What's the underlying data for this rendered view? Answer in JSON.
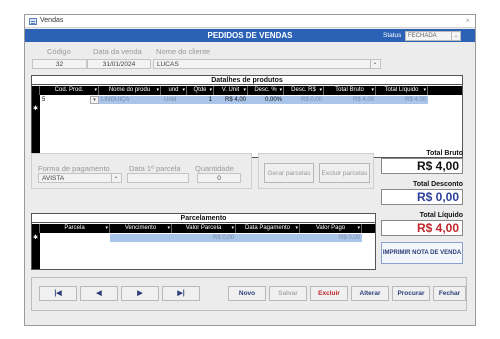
{
  "window": {
    "title": "Vendas",
    "close_glyph": "×"
  },
  "header": {
    "title": "PEDIDOS DE VENDAS",
    "status_label": "Status",
    "status_value": "FECHADA"
  },
  "fields": {
    "codigo_label": "Código",
    "codigo_value": "32",
    "data_label": "Data da venda",
    "data_value": "31/01/2024",
    "cliente_label": "Nome do cliente",
    "cliente_value": "LUCAS"
  },
  "products": {
    "caption": "Datalhes de produtos",
    "columns": [
      "Cod. Prod.",
      "Nome do produ",
      "und",
      "Qtde",
      "V. Unit",
      "Desc. %",
      "Desc. R$",
      "Total Bruto",
      "Total Líquido"
    ],
    "row": {
      "cod": "5",
      "nome": "LINGUIÇA",
      "und": "Unid",
      "qtde": "1",
      "vunit": "R$ 4,00",
      "desc_pct": "0,00%",
      "desc_rs": "R$ 0,00",
      "total_bruto": "R$ 4,00",
      "total_liquido": "R$ 4,00"
    },
    "new_row_marker": "✱"
  },
  "payment": {
    "forma_label": "Forma de pagamento",
    "forma_value": "AVISTA",
    "parcela_label": "Data 1ª parcela",
    "parcela_value": "",
    "quantidade_label": "Quantidade",
    "quantidade_value": "0",
    "gerar_label": "Gerar parcelas",
    "excluir_label": "Excluir parcelas"
  },
  "totals": {
    "bruto_label": "Total Bruto",
    "bruto_value": "R$ 4,00",
    "desconto_label": "Total Desconto",
    "desconto_value": "R$ 0,00",
    "liquido_label": "Total Líquido",
    "liquido_value": "R$ 4,00",
    "print_label": "IMPRIMIR NOTA DE VENDA",
    "colors": {
      "bruto": "#111111",
      "desconto": "#2b3f9a",
      "liquido": "#c0262b"
    }
  },
  "installments": {
    "caption": "Parcelamento",
    "columns": [
      "Parcela",
      "Vencimento",
      "Valor Parcela",
      "Data Pagamento",
      "Valor Pago"
    ],
    "row": {
      "parcela": "",
      "vencimento": "",
      "valor_parcela": "R$ 0,00",
      "data_pagamento": "",
      "valor_pago": "R$ 0,00"
    },
    "new_row_marker": "✱"
  },
  "nav": {
    "first": "|◀",
    "prev": "◀",
    "next": "▶",
    "last": "▶|"
  },
  "actions": {
    "novo": "Novo",
    "salvar": "Salvar",
    "excluir": "Excluir",
    "alterar": "Alterar",
    "procurar": "Procurar",
    "fechar": "Fechar"
  },
  "dropdown_glyph": "▾",
  "select_glyph": "⌄"
}
